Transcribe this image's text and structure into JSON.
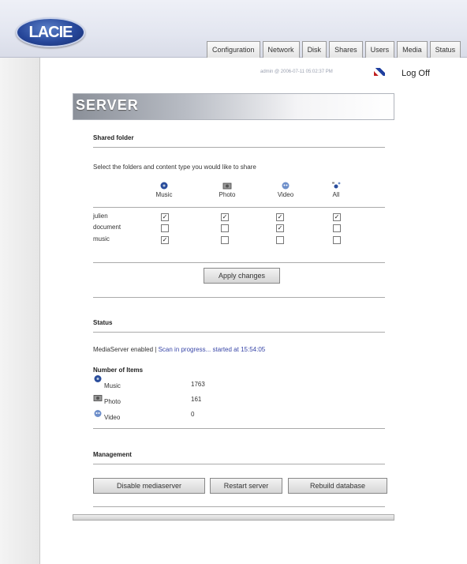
{
  "logo_text": "LACIE",
  "tabs": [
    "Configuration",
    "Network",
    "Disk",
    "Shares",
    "Users",
    "Media",
    "Status"
  ],
  "meta": "admin @ 2006-07-11 05:02:37 PM",
  "logoff": "Log Off",
  "panel_title": "SERVER",
  "shared": {
    "heading": "Shared folder",
    "instruction": "Select the folders and content type you would like to share",
    "columns": [
      "Music",
      "Photo",
      "Video",
      "All"
    ],
    "rows": [
      {
        "name": "julien",
        "checks": [
          true,
          true,
          true,
          true
        ]
      },
      {
        "name": "document",
        "checks": [
          false,
          false,
          true,
          false
        ]
      },
      {
        "name": "music",
        "checks": [
          true,
          false,
          false,
          false
        ]
      }
    ],
    "apply_label": "Apply changes"
  },
  "status": {
    "heading": "Status",
    "line_static": "MediaServer enabled | ",
    "line_link": "Scan in progress... started at 15:54:05",
    "number_heading": "Number of Items",
    "items": [
      {
        "label": "Music",
        "count": "1763",
        "icon": "music-icon"
      },
      {
        "label": "Photo",
        "count": "161",
        "icon": "photo-icon"
      },
      {
        "label": "Video",
        "count": "0",
        "icon": "video-icon"
      }
    ]
  },
  "management": {
    "heading": "Management",
    "buttons": [
      "Disable mediaserver",
      "Restart server",
      "Rebuild database"
    ]
  },
  "colors": {
    "accent": "#27479a",
    "link": "#3947a8"
  }
}
